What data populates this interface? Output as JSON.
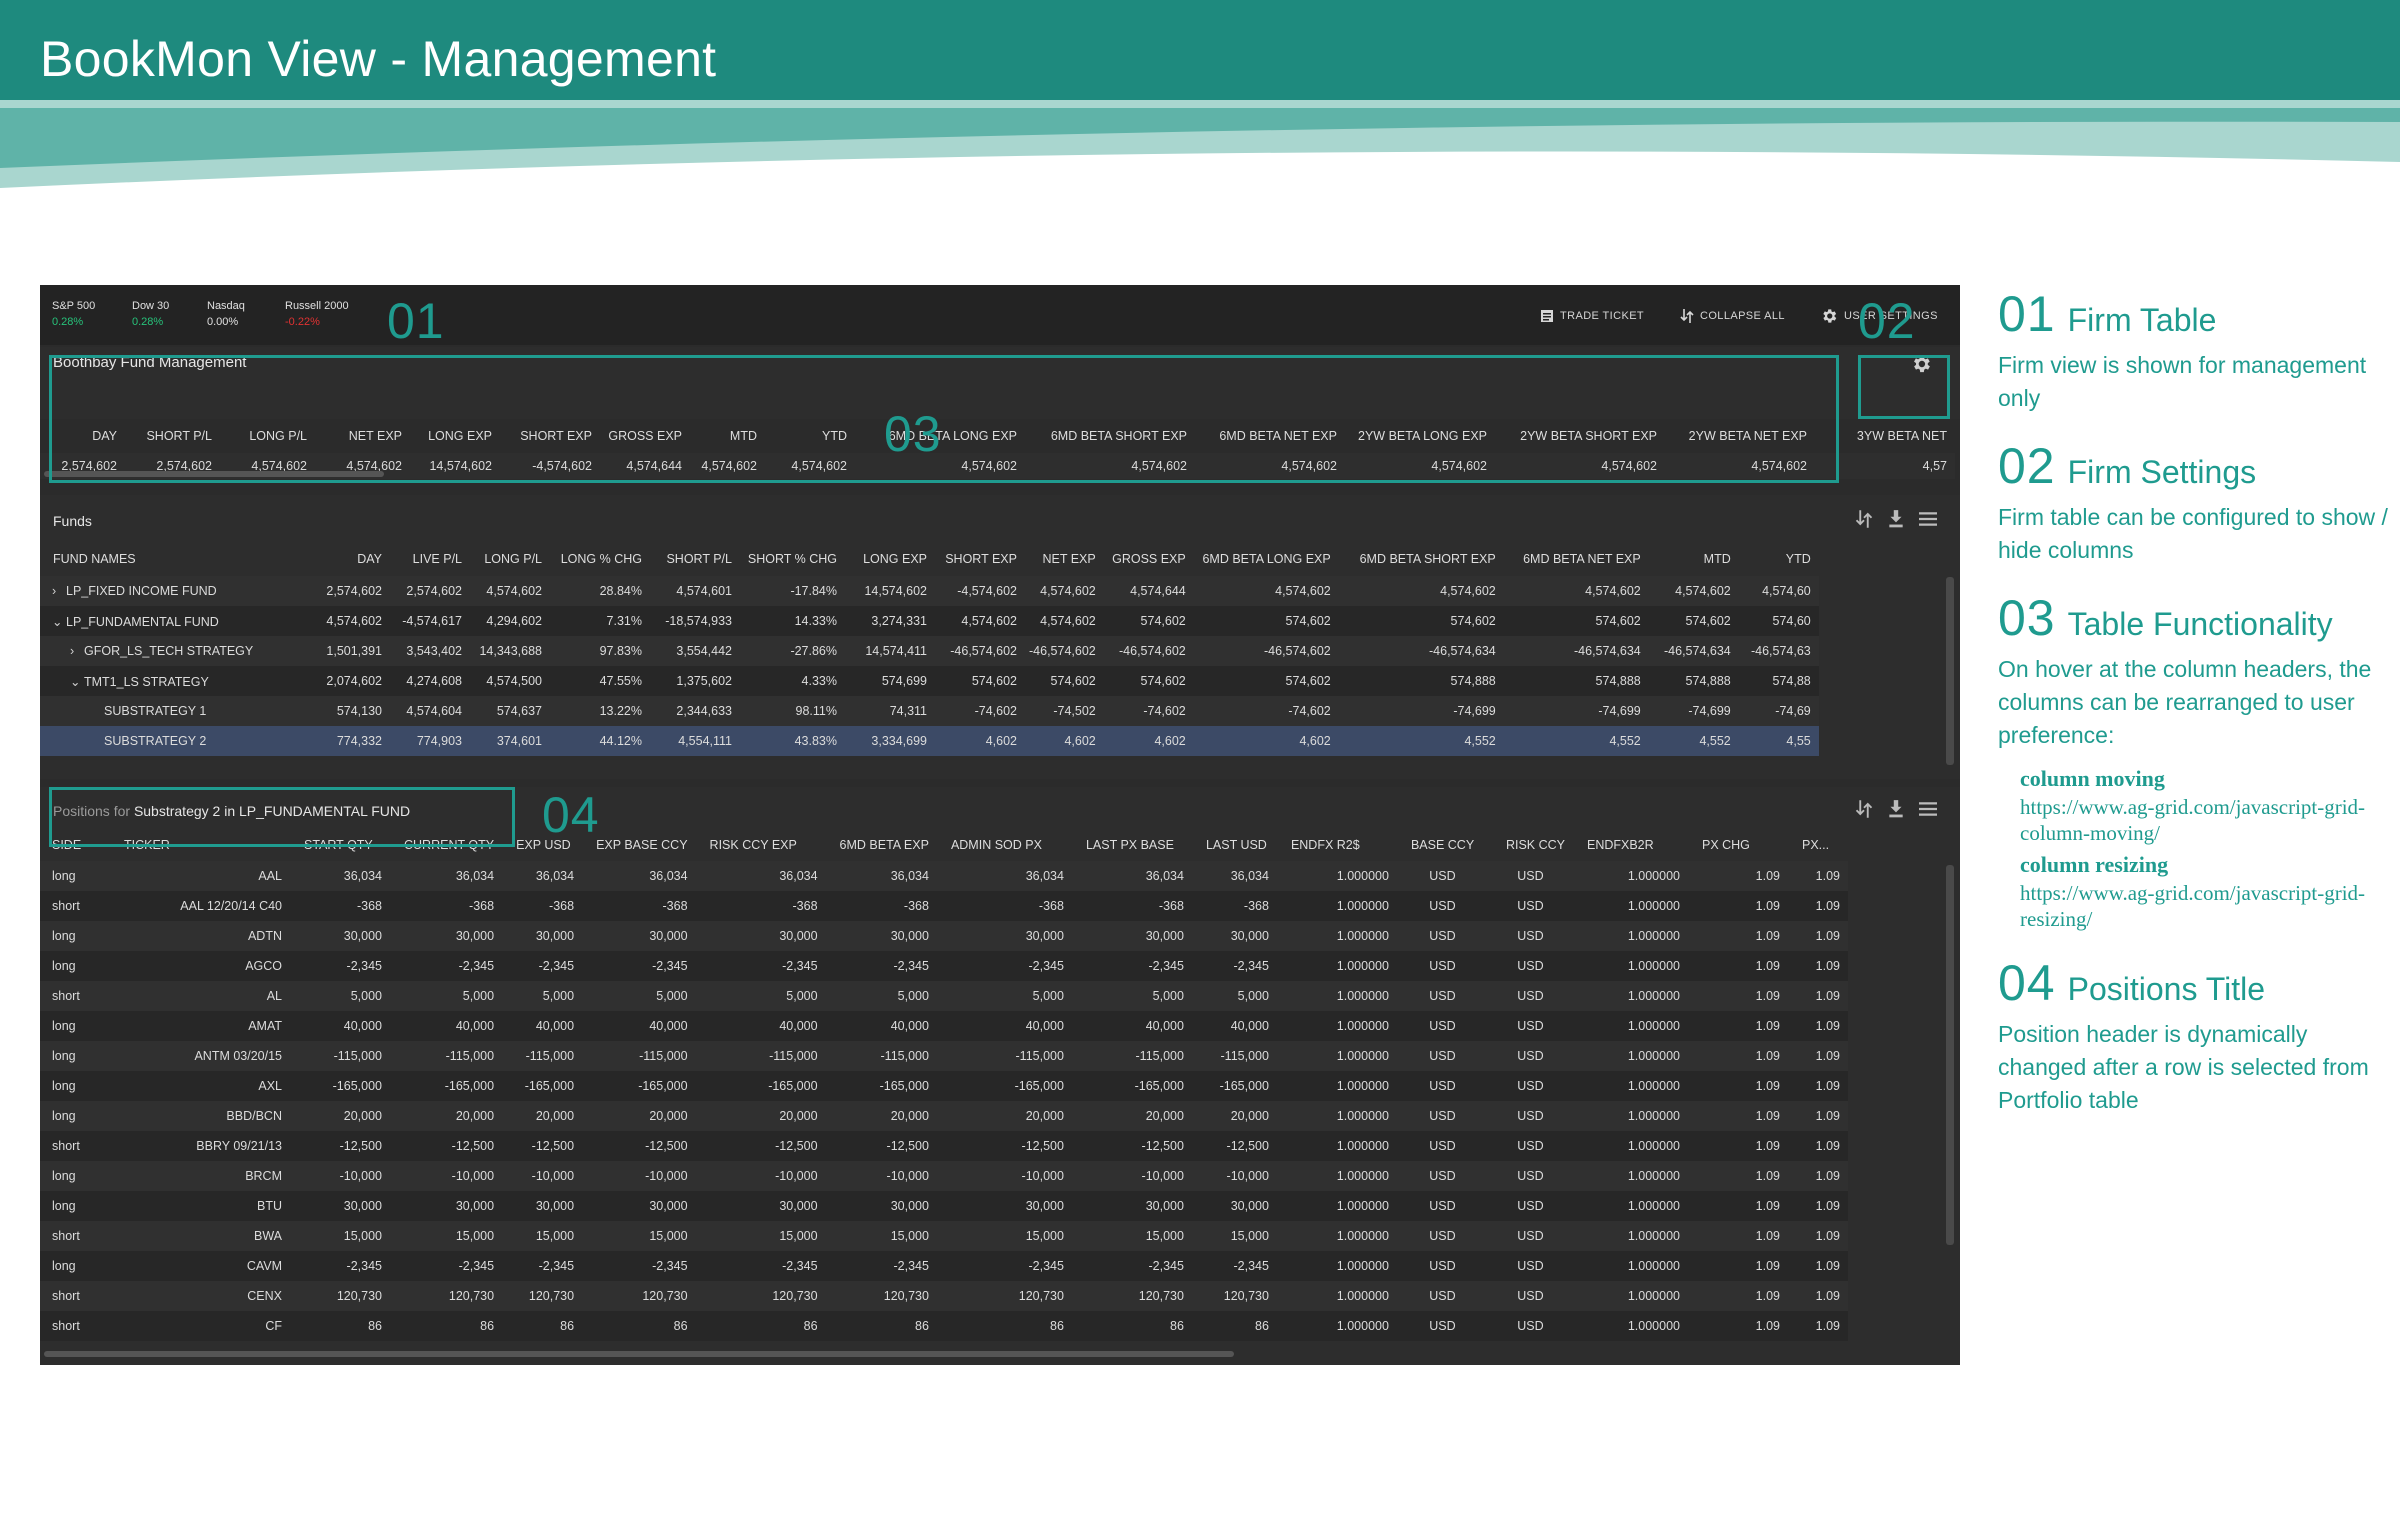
{
  "page": {
    "title": "BookMon View - Management",
    "accent_color": "#1f9b8f",
    "banner_color": "#1e8a7e"
  },
  "markets": [
    {
      "name": "S&P 500",
      "value": "0.28%",
      "trend": "pos"
    },
    {
      "name": "Dow 30",
      "value": "0.28%",
      "trend": "pos"
    },
    {
      "name": "Nasdaq",
      "value": "0.00%",
      "trend": "neu"
    },
    {
      "name": "Russell 2000",
      "value": "-0.22%",
      "trend": "neg"
    }
  ],
  "toolbar": {
    "trade_ticket": "TRADE TICKET",
    "collapse_all": "COLLAPSE ALL",
    "user_settings": "USER SETTINGS",
    "icons": [
      "trade-ticket-icon",
      "collapse-icon",
      "gear-icon"
    ]
  },
  "firm": {
    "title": "Boothbay Fund Management",
    "columns": [
      "DAY",
      "SHORT P/L",
      "LONG P/L",
      "NET EXP",
      "LONG EXP",
      "SHORT EXP",
      "GROSS EXP",
      "MTD",
      "YTD",
      "6MD BETA LONG EXP",
      "6MD BETA SHORT EXP",
      "6MD BETA NET EXP",
      "2YW BETA LONG EXP",
      "2YW BETA SHORT EXP",
      "2YW BETA NET EXP",
      "3YW BETA NET"
    ],
    "values": [
      "2,574,602",
      "2,574,602",
      "4,574,602",
      "4,574,602",
      "14,574,602",
      "-4,574,602",
      "4,574,644",
      "4,574,602",
      "4,574,602",
      "4,574,602",
      "4,574,602",
      "4,574,602",
      "4,574,602",
      "4,574,602",
      "4,574,602",
      "4,57"
    ]
  },
  "funds": {
    "title": "Funds",
    "columns": [
      "FUND NAMES",
      "DAY",
      "LIVE P/L",
      "LONG P/L",
      "LONG % CHG",
      "SHORT P/L",
      "SHORT % CHG",
      "LONG EXP",
      "SHORT EXP",
      "NET EXP",
      "GROSS EXP",
      "6MD BETA LONG EXP",
      "6MD BETA SHORT EXP",
      "6MD BETA NET EXP",
      "MTD",
      "YTD"
    ],
    "rows": [
      {
        "expander": "›",
        "name": "LP_FIXED INCOME FUND",
        "cells": [
          "2,574,602",
          "2,574,602",
          "4,574,602",
          "28.84%",
          "4,574,601",
          "-17.84%",
          "14,574,602",
          "-4,574,602",
          "4,574,602",
          "4,574,644",
          "4,574,602",
          "4,574,602",
          "4,574,602",
          "4,574,602",
          "4,574,60"
        ]
      },
      {
        "expander": "⌄",
        "name": "LP_FUNDAMENTAL FUND",
        "cells": [
          "4,574,602",
          "-4,574,617",
          "4,294,602",
          "7.31%",
          "-18,574,933",
          "14.33%",
          "3,274,331",
          "4,574,602",
          "4,574,602",
          "574,602",
          "574,602",
          "574,602",
          "574,602",
          "574,602",
          "574,60"
        ]
      },
      {
        "expander": "›",
        "name": "GFOR_LS_TECH STRATEGY",
        "cells": [
          "1,501,391",
          "3,543,402",
          "14,343,688",
          "97.83%",
          "3,554,442",
          "-27.86%",
          "14,574,411",
          "-46,574,602",
          "-46,574,602",
          "-46,574,602",
          "-46,574,602",
          "-46,574,634",
          "-46,574,634",
          "-46,574,634",
          "-46,574,63"
        ]
      },
      {
        "expander": "⌄",
        "name": "TMT1_LS STRATEGY",
        "cells": [
          "2,074,602",
          "4,274,608",
          "4,574,500",
          "47.55%",
          "1,375,602",
          "4.33%",
          "574,699",
          "574,602",
          "574,602",
          "574,602",
          "574,602",
          "574,888",
          "574,888",
          "574,888",
          "574,88"
        ]
      },
      {
        "expander": "",
        "name": "SUBSTRATEGY 1",
        "cells": [
          "574,130",
          "4,574,604",
          "574,637",
          "13.22%",
          "2,344,633",
          "98.11%",
          "74,311",
          "-74,602",
          "-74,502",
          "-74,602",
          "-74,602",
          "-74,699",
          "-74,699",
          "-74,699",
          "-74,69"
        ]
      },
      {
        "expander": "",
        "name": "SUBSTRATEGY 2",
        "cells": [
          "774,332",
          "774,903",
          "374,601",
          "44.12%",
          "4,554,111",
          "43.83%",
          "3,334,699",
          "4,602",
          "4,602",
          "4,602",
          "4,602",
          "4,552",
          "4,552",
          "4,552",
          "4,55"
        ]
      }
    ]
  },
  "positions": {
    "title_prefix": "Positions for ",
    "title_subject": "Substrategy 2 in LP_FUNDAMENTAL FUND",
    "columns": [
      "SIDE",
      "TICKER",
      "START QTY",
      "CURRENT QTY",
      "EXP USD",
      "EXP BASE CCY",
      "RISK CCY EXP",
      "6MD BETA EXP",
      "ADMIN SOD PX",
      "LAST PX BASE",
      "LAST USD",
      "ENDFX R2$",
      "BASE CCY",
      "RISK CCY",
      "ENDFXB2R",
      "PX CHG",
      "PX..."
    ],
    "rows": [
      [
        "long",
        "AAL",
        "36,034",
        "36,034",
        "36,034",
        "36,034",
        "36,034",
        "36,034",
        "36,034",
        "36,034",
        "36,034",
        "1.000000",
        "USD",
        "USD",
        "1.000000",
        "1.09",
        "1.09"
      ],
      [
        "short",
        "AAL 12/20/14 C40",
        "-368",
        "-368",
        "-368",
        "-368",
        "-368",
        "-368",
        "-368",
        "-368",
        "-368",
        "1.000000",
        "USD",
        "USD",
        "1.000000",
        "1.09",
        "1.09"
      ],
      [
        "long",
        "ADTN",
        "30,000",
        "30,000",
        "30,000",
        "30,000",
        "30,000",
        "30,000",
        "30,000",
        "30,000",
        "30,000",
        "1.000000",
        "USD",
        "USD",
        "1.000000",
        "1.09",
        "1.09"
      ],
      [
        "long",
        "AGCO",
        "-2,345",
        "-2,345",
        "-2,345",
        "-2,345",
        "-2,345",
        "-2,345",
        "-2,345",
        "-2,345",
        "-2,345",
        "1.000000",
        "USD",
        "USD",
        "1.000000",
        "1.09",
        "1.09"
      ],
      [
        "short",
        "AL",
        "5,000",
        "5,000",
        "5,000",
        "5,000",
        "5,000",
        "5,000",
        "5,000",
        "5,000",
        "5,000",
        "1.000000",
        "USD",
        "USD",
        "1.000000",
        "1.09",
        "1.09"
      ],
      [
        "long",
        "AMAT",
        "40,000",
        "40,000",
        "40,000",
        "40,000",
        "40,000",
        "40,000",
        "40,000",
        "40,000",
        "40,000",
        "1.000000",
        "USD",
        "USD",
        "1.000000",
        "1.09",
        "1.09"
      ],
      [
        "long",
        "ANTM 03/20/15",
        "-115,000",
        "-115,000",
        "-115,000",
        "-115,000",
        "-115,000",
        "-115,000",
        "-115,000",
        "-115,000",
        "-115,000",
        "1.000000",
        "USD",
        "USD",
        "1.000000",
        "1.09",
        "1.09"
      ],
      [
        "long",
        "AXL",
        "-165,000",
        "-165,000",
        "-165,000",
        "-165,000",
        "-165,000",
        "-165,000",
        "-165,000",
        "-165,000",
        "-165,000",
        "1.000000",
        "USD",
        "USD",
        "1.000000",
        "1.09",
        "1.09"
      ],
      [
        "long",
        "BBD/BCN",
        "20,000",
        "20,000",
        "20,000",
        "20,000",
        "20,000",
        "20,000",
        "20,000",
        "20,000",
        "20,000",
        "1.000000",
        "USD",
        "USD",
        "1.000000",
        "1.09",
        "1.09"
      ],
      [
        "short",
        "BBRY 09/21/13",
        "-12,500",
        "-12,500",
        "-12,500",
        "-12,500",
        "-12,500",
        "-12,500",
        "-12,500",
        "-12,500",
        "-12,500",
        "1.000000",
        "USD",
        "USD",
        "1.000000",
        "1.09",
        "1.09"
      ],
      [
        "long",
        "BRCM",
        "-10,000",
        "-10,000",
        "-10,000",
        "-10,000",
        "-10,000",
        "-10,000",
        "-10,000",
        "-10,000",
        "-10,000",
        "1.000000",
        "USD",
        "USD",
        "1.000000",
        "1.09",
        "1.09"
      ],
      [
        "long",
        "BTU",
        "30,000",
        "30,000",
        "30,000",
        "30,000",
        "30,000",
        "30,000",
        "30,000",
        "30,000",
        "30,000",
        "1.000000",
        "USD",
        "USD",
        "1.000000",
        "1.09",
        "1.09"
      ],
      [
        "short",
        "BWA",
        "15,000",
        "15,000",
        "15,000",
        "15,000",
        "15,000",
        "15,000",
        "15,000",
        "15,000",
        "15,000",
        "1.000000",
        "USD",
        "USD",
        "1.000000",
        "1.09",
        "1.09"
      ],
      [
        "long",
        "CAVM",
        "-2,345",
        "-2,345",
        "-2,345",
        "-2,345",
        "-2,345",
        "-2,345",
        "-2,345",
        "-2,345",
        "-2,345",
        "1.000000",
        "USD",
        "USD",
        "1.000000",
        "1.09",
        "1.09"
      ],
      [
        "short",
        "CENX",
        "120,730",
        "120,730",
        "120,730",
        "120,730",
        "120,730",
        "120,730",
        "120,730",
        "120,730",
        "120,730",
        "1.000000",
        "USD",
        "USD",
        "1.000000",
        "1.09",
        "1.09"
      ],
      [
        "short",
        "CF",
        "86",
        "86",
        "86",
        "86",
        "86",
        "86",
        "86",
        "86",
        "86",
        "1.000000",
        "USD",
        "USD",
        "1.000000",
        "1.09",
        "1.09"
      ]
    ]
  },
  "callouts": [
    "01",
    "02",
    "03",
    "04"
  ],
  "notes": [
    {
      "num": "01",
      "title": "Firm Table",
      "text": "Firm view is shown for management only"
    },
    {
      "num": "02",
      "title": "Firm Settings",
      "text": "Firm table can be configured to show / hide columns"
    },
    {
      "num": "03",
      "title": "Table Functionality",
      "text": "On hover at the column headers, the columns can be rearranged to user preference:",
      "links": [
        {
          "title": "column moving",
          "url": "https://www.ag-grid.com/javascript-grid-column-moving/"
        },
        {
          "title": "column resizing",
          "url": "https://www.ag-grid.com/javascript-grid-resizing/"
        }
      ]
    },
    {
      "num": "04",
      "title": "Positions Title",
      "text": "Position header is dynamically changed after a row is selected from Portfolio table"
    }
  ]
}
